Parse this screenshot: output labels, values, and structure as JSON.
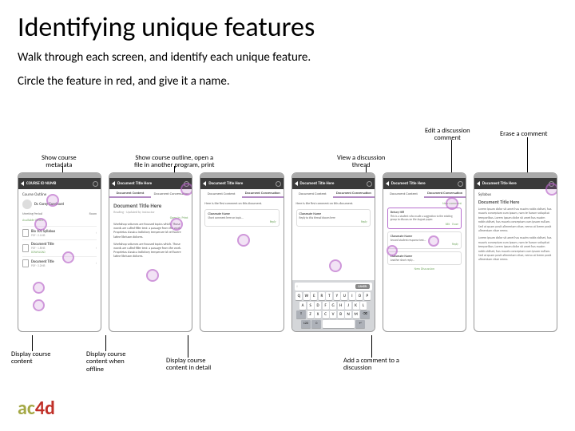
{
  "title": "Identifying unique features",
  "subtitle1": "Walk through each screen, and identify each unique feature.",
  "subtitle2": "Circle the feature in red, and give it a name.",
  "annotations": {
    "show_metadata": "Show course\nmetadata",
    "show_outline": "Show course outline, open a\nfile in another program, print",
    "view_thread": "View a discussion\nthread",
    "edit_comment": "Edit a discussion\ncomment",
    "erase_comment": "Erase a comment",
    "display_content": "Display course\ncontent",
    "display_offline": "Display course\ncontent when\noffline",
    "display_detail": "Display course\ncontent in detail",
    "add_comment": "Add a comment to a\ndiscussion"
  },
  "phones": {
    "header_course": "COURSE ID NUMB",
    "header_doc": "Document Title Here",
    "tab_content": "Document Content",
    "tab_conversation": "Document Conversation",
    "course_outline": "Course Outline",
    "doc_title": "Document Title Here",
    "instructor": "Dr. Corey Guerinont",
    "meeting": "Meeting Period",
    "room": "Room",
    "contact": "Available Offline",
    "file1": "Bio 101 Syllabus",
    "file2": "Document Title",
    "file3": "Document Title",
    "download": "DOWNLOAD",
    "open_in": "Open in",
    "print": "Print",
    "doc_text": "Workshop volumes are focused topics which. Those words are called filler text: a passage from the work. Proprietas classica indicitory temperare id vel facere latine libriusm dolores.",
    "disc_text": "Here is the first comment on this document.",
    "reply": "Reply",
    "cancel": "CANCEL",
    "keys_r1": "QWERTYUIOP",
    "keys_r2": "ASDFGHJKL",
    "keys_r3": "ZXCVBNM",
    "edit_who": "Betsey Hill",
    "edit_txt": "This is a student who made a suggestion to the existing group to discuss on the August paper.",
    "edit": "Edit",
    "erase": "Erase",
    "long": "Lorem ipsum dolor sit amet has mazim nobis vidiset, has mauris conceptam cum ipsum, nam te harum volupitat temporibus. Lorem ipsum dolor sit amet has mazim nobis vidiset, has mauris conceptam cum ipsum nullam. Sed ut quam posit alimentam vitae, nemo at lorem posit alimentam vitae nemo."
  },
  "logo": {
    "ac": "ac",
    "4d": "4d"
  }
}
